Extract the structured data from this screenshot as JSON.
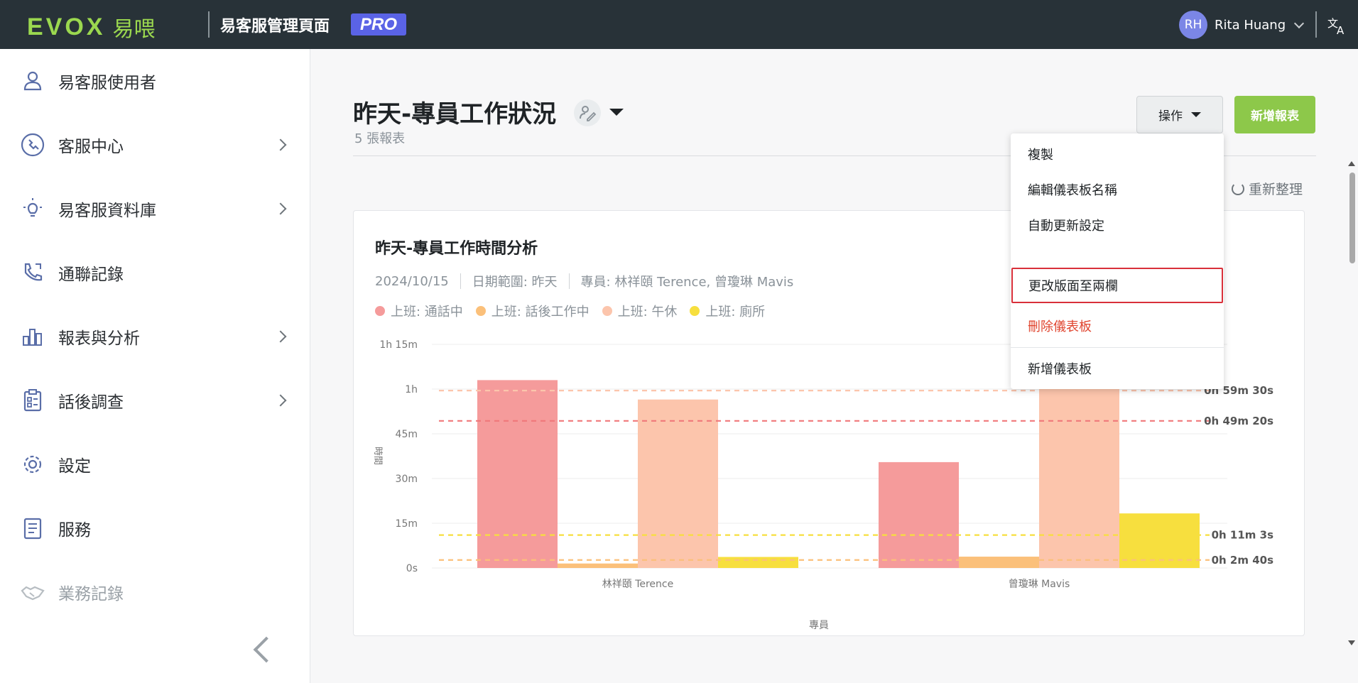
{
  "topbar": {
    "logo_text": "EVOX",
    "logo_cn": "易喂",
    "app_title": "易客服管理頁面",
    "pro_badge": "PRO",
    "user_initials": "RH",
    "user_name": "Rita Huang",
    "lang_icon": "translate-icon"
  },
  "sidebar": {
    "items": [
      {
        "label": "易客服使用者",
        "icon": "user-icon",
        "has_children": false
      },
      {
        "label": "客服中心",
        "icon": "call-center-icon",
        "has_children": true
      },
      {
        "label": "易客服資料庫",
        "icon": "lightbulb-icon",
        "has_children": true
      },
      {
        "label": "通聯記錄",
        "icon": "phone-log-icon",
        "has_children": false
      },
      {
        "label": "報表與分析",
        "icon": "bar-chart-icon",
        "has_children": true
      },
      {
        "label": "話後調查",
        "icon": "clipboard-icon",
        "has_children": true
      },
      {
        "label": "設定",
        "icon": "gear-icon",
        "has_children": false
      },
      {
        "label": "服務",
        "icon": "service-list-icon",
        "has_children": false
      },
      {
        "label": "業務記錄",
        "icon": "handshake-icon",
        "has_children": false,
        "muted": true
      }
    ]
  },
  "main": {
    "title": "昨天-專員工作狀況",
    "subtitle": "5 張報表",
    "ops_button": "操作",
    "add_button": "新增報表",
    "refresh": "重新整理"
  },
  "menu": {
    "items": [
      {
        "label": "複製"
      },
      {
        "label": "編輯儀表板名稱"
      },
      {
        "label": "自動更新設定"
      },
      {
        "label": "更改版面至兩欄",
        "focused": true
      },
      {
        "label": "刪除儀表板",
        "danger": true
      },
      {
        "label": "新增儀表板"
      }
    ]
  },
  "card": {
    "title": "昨天-專員工作時間分析",
    "date": "2024/10/15",
    "range": "日期範圍: 昨天",
    "agents": "專員: 林祥頤 Terence, 曾瓊琳 Mavis"
  },
  "chart_data": {
    "type": "bar",
    "title": "昨天-專員工作時間分析",
    "xlabel": "專員",
    "ylabel": "時間",
    "categories": [
      "林祥頤 Terence",
      "曾瓊琳 Mavis"
    ],
    "y_ticks": [
      "0s",
      "15m",
      "30m",
      "45m",
      "1h",
      "1h 15m"
    ],
    "ylim_minutes": [
      0,
      75
    ],
    "grid": true,
    "legend_position": "top-left",
    "series": [
      {
        "name": "上班: 通話中",
        "color": "#f59b9b",
        "values_minutes": [
          63,
          35.5
        ]
      },
      {
        "name": "上班: 話後工作中",
        "color": "#fbc07a",
        "values_minutes": [
          1.5,
          3.8
        ]
      },
      {
        "name": "上班: 午休",
        "color": "#fcc5ac",
        "values_minutes": [
          56.5,
          63.5
        ]
      },
      {
        "name": "上班: 廁所",
        "color": "#f7df3e",
        "values_minutes": [
          3.7,
          18.3
        ]
      }
    ],
    "reference_lines": [
      {
        "label": "0h 59m 30s",
        "value_minutes": 59.5,
        "color": "#fcc5ac"
      },
      {
        "label": "0h 49m 20s",
        "value_minutes": 49.33,
        "color": "#f0787a"
      },
      {
        "label": "0h 11m 3s",
        "value_minutes": 11.05,
        "color": "#f7df3e"
      },
      {
        "label": "0h 2m 40s",
        "value_minutes": 2.67,
        "color": "#fbc07a"
      }
    ]
  }
}
